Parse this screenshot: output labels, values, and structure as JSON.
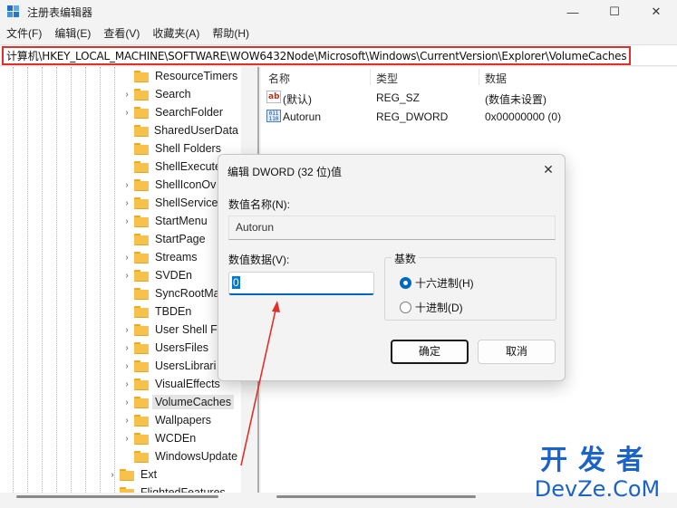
{
  "window": {
    "title": "注册表编辑器",
    "minimize": "—",
    "maximize": "☐",
    "close": "✕"
  },
  "menu": [
    "文件(F)",
    "编辑(E)",
    "查看(V)",
    "收藏夹(A)",
    "帮助(H)"
  ],
  "address": "计算机\\HKEY_LOCAL_MACHINE\\SOFTWARE\\WOW6432Node\\Microsoft\\Windows\\CurrentVersion\\Explorer\\VolumeCaches",
  "tree": {
    "items": [
      {
        "label": "ResourceTimers",
        "chevron": ""
      },
      {
        "label": "Search",
        "chevron": "›"
      },
      {
        "label": "SearchFolder",
        "chevron": "›"
      },
      {
        "label": "SharedUserData",
        "chevron": ""
      },
      {
        "label": "Shell Folders",
        "chevron": ""
      },
      {
        "label": "ShellExecute",
        "chevron": ""
      },
      {
        "label": "ShellIconOv",
        "chevron": "›"
      },
      {
        "label": "ShellService",
        "chevron": "›"
      },
      {
        "label": "StartMenu",
        "chevron": "›"
      },
      {
        "label": "StartPage",
        "chevron": ""
      },
      {
        "label": "Streams",
        "chevron": "›"
      },
      {
        "label": "SVDEn",
        "chevron": "›"
      },
      {
        "label": "SyncRootMa",
        "chevron": ""
      },
      {
        "label": "TBDEn",
        "chevron": ""
      },
      {
        "label": "User Shell Fo",
        "chevron": "›"
      },
      {
        "label": "UsersFiles",
        "chevron": "›"
      },
      {
        "label": "UsersLibrari",
        "chevron": "›"
      },
      {
        "label": "VisualEffects",
        "chevron": "›"
      },
      {
        "label": "VolumeCaches",
        "chevron": "›"
      },
      {
        "label": "Wallpapers",
        "chevron": "›"
      },
      {
        "label": "WCDEn",
        "chevron": "›"
      },
      {
        "label": "WindowsUpdate",
        "chevron": ""
      },
      {
        "label": "Ext",
        "chevron": "›"
      },
      {
        "label": "FlightedFeatures",
        "chevron": ""
      }
    ],
    "selected": "VolumeCaches"
  },
  "list": {
    "headers": {
      "name": "名称",
      "type": "类型",
      "data": "数据"
    },
    "rows": [
      {
        "icon": "string-value-icon",
        "icon_text": "ab",
        "name": "(默认)",
        "type": "REG_SZ",
        "data": "(数值未设置)"
      },
      {
        "icon": "binary-value-icon",
        "icon_text": "011 110",
        "name": "Autorun",
        "type": "REG_DWORD",
        "data": "0x00000000 (0)"
      }
    ]
  },
  "dialog": {
    "title": "编辑 DWORD (32 位)值",
    "close": "✕",
    "name_label": "数值名称(N):",
    "name_value": "Autorun",
    "data_label": "数值数据(V):",
    "data_value": "0",
    "base_label": "基数",
    "hex_label": "十六进制(H)",
    "dec_label": "十进制(D)",
    "base_selected": "hex",
    "ok_label": "确定",
    "cancel_label": "取消"
  },
  "colors": {
    "highlight_border": "#e0302a",
    "accent": "#0067c0",
    "watermark": "#1b63c6"
  },
  "watermark": {
    "line1": "开发者",
    "line2": "DevZe.CoM"
  }
}
